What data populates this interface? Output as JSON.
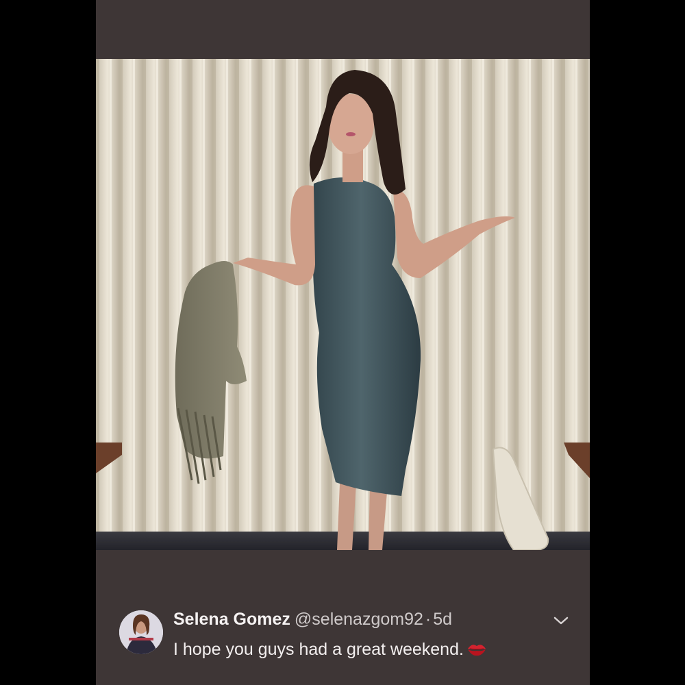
{
  "tweet": {
    "display_name": "Selena Gomez",
    "handle": "@selenazgom92",
    "separator": "·",
    "age": "5d",
    "text": "I hope you guys had a great weekend.",
    "text_emoji_icon": "kiss-mark-icon",
    "menu_icon": "chevron-down-icon"
  },
  "photo": {
    "subject": "woman-in-grey-dress-photo"
  },
  "colors": {
    "panel_bg": "#3e3636",
    "page_bg": "#000000"
  }
}
